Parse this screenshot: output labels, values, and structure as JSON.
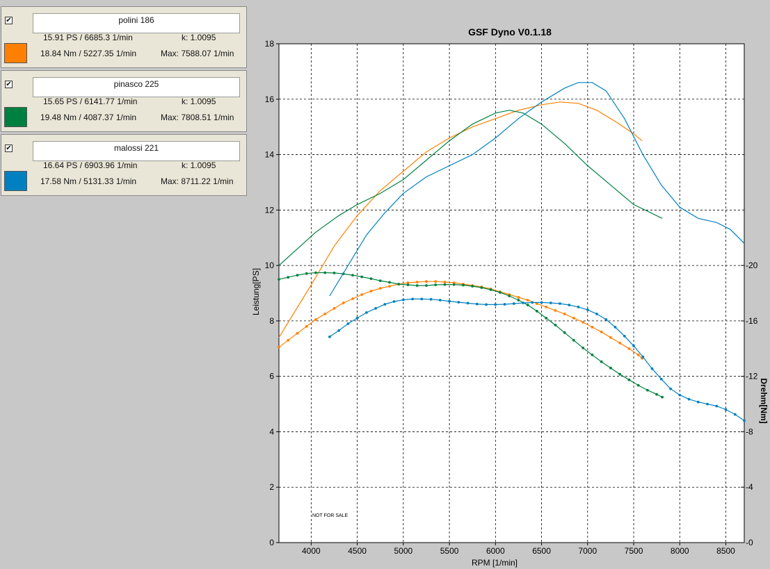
{
  "panels": [
    {
      "checked": true,
      "check_glyph": "✔",
      "name": "polini 186",
      "color": "#ff8000",
      "ps_line": "15.91 PS / 6685.3 1/min",
      "nm_line": "18.84 Nm / 5227.35 1/min",
      "k_line": "k: 1.0095",
      "max_line": "Max: 7588.07 1/min"
    },
    {
      "checked": true,
      "check_glyph": "✔",
      "name": "pinasco 225",
      "color": "#008040",
      "ps_line": "15.65 PS / 6141.77 1/min",
      "nm_line": "19.48 Nm / 4087.37 1/min",
      "k_line": "k: 1.0095",
      "max_line": "Max: 7808.51 1/min"
    },
    {
      "checked": true,
      "check_glyph": "✔",
      "name": "malossi 221",
      "color": "#0080c0",
      "ps_line": "16.64 PS / 6903.96 1/min",
      "nm_line": "17.58 Nm / 5131.33 1/min",
      "k_line": "k: 1.0095",
      "max_line": "Max: 8711.22 1/min"
    }
  ],
  "chart_data": {
    "type": "line",
    "title": "GSF Dyno V0.1.18",
    "xlabel": "RPM [1/min]",
    "ylabel": "Leistung[PS]",
    "y2label": "Drehm[Nm]",
    "watermark": "NOT FOR SALE",
    "xlim": [
      3650,
      8700
    ],
    "ylim": [
      0,
      18
    ],
    "y2lim": [
      0,
      36
    ],
    "x_ticks": [
      4000,
      4500,
      5000,
      5500,
      6000,
      6500,
      7000,
      7500,
      8000,
      8500
    ],
    "y_ticks": [
      0,
      2,
      4,
      6,
      8,
      10,
      12,
      14,
      16,
      18
    ],
    "y2_ticks": [
      0,
      4,
      8,
      12,
      16,
      20
    ],
    "grid": true,
    "series": [
      {
        "name": "polini 186",
        "color": "#ff8000",
        "power": [
          [
            3650,
            7.4
          ],
          [
            4000,
            9.3
          ],
          [
            4250,
            10.7
          ],
          [
            4500,
            11.8
          ],
          [
            4750,
            12.7
          ],
          [
            5000,
            13.4
          ],
          [
            5250,
            14.1
          ],
          [
            5500,
            14.6
          ],
          [
            5750,
            15.0
          ],
          [
            6000,
            15.3
          ],
          [
            6250,
            15.6
          ],
          [
            6500,
            15.8
          ],
          [
            6700,
            15.9
          ],
          [
            6900,
            15.85
          ],
          [
            7100,
            15.6
          ],
          [
            7300,
            15.2
          ],
          [
            7500,
            14.75
          ],
          [
            7590,
            14.5
          ]
        ],
        "torque": [
          [
            3650,
            14.1
          ],
          [
            3750,
            14.6
          ],
          [
            3850,
            15.1
          ],
          [
            3950,
            15.6
          ],
          [
            4050,
            16.1
          ],
          [
            4150,
            16.5
          ],
          [
            4250,
            16.9
          ],
          [
            4350,
            17.3
          ],
          [
            4450,
            17.6
          ],
          [
            4550,
            17.9
          ],
          [
            4650,
            18.15
          ],
          [
            4750,
            18.35
          ],
          [
            4850,
            18.5
          ],
          [
            4950,
            18.65
          ],
          [
            5050,
            18.75
          ],
          [
            5150,
            18.8
          ],
          [
            5250,
            18.84
          ],
          [
            5350,
            18.84
          ],
          [
            5450,
            18.8
          ],
          [
            5550,
            18.75
          ],
          [
            5650,
            18.65
          ],
          [
            5750,
            18.55
          ],
          [
            5850,
            18.45
          ],
          [
            5950,
            18.3
          ],
          [
            6050,
            18.1
          ],
          [
            6150,
            17.9
          ],
          [
            6250,
            17.7
          ],
          [
            6350,
            17.5
          ],
          [
            6450,
            17.25
          ],
          [
            6550,
            17.0
          ],
          [
            6650,
            16.75
          ],
          [
            6750,
            16.5
          ],
          [
            6850,
            16.2
          ],
          [
            6950,
            15.9
          ],
          [
            7050,
            15.55
          ],
          [
            7150,
            15.2
          ],
          [
            7250,
            14.8
          ],
          [
            7350,
            14.4
          ],
          [
            7450,
            14.0
          ],
          [
            7550,
            13.55
          ],
          [
            7590,
            13.3
          ]
        ]
      },
      {
        "name": "pinasco 225",
        "color": "#008040",
        "power": [
          [
            3650,
            10.0
          ],
          [
            3850,
            10.6
          ],
          [
            4050,
            11.2
          ],
          [
            4300,
            11.8
          ],
          [
            4500,
            12.2
          ],
          [
            4750,
            12.6
          ],
          [
            5000,
            13.1
          ],
          [
            5250,
            13.8
          ],
          [
            5500,
            14.5
          ],
          [
            5750,
            15.1
          ],
          [
            6000,
            15.5
          ],
          [
            6150,
            15.6
          ],
          [
            6300,
            15.5
          ],
          [
            6500,
            15.1
          ],
          [
            6750,
            14.4
          ],
          [
            7000,
            13.6
          ],
          [
            7250,
            12.9
          ],
          [
            7500,
            12.2
          ],
          [
            7810,
            11.7
          ]
        ],
        "torque": [
          [
            3650,
            19.0
          ],
          [
            3750,
            19.15
          ],
          [
            3850,
            19.3
          ],
          [
            3950,
            19.42
          ],
          [
            4050,
            19.48
          ],
          [
            4150,
            19.48
          ],
          [
            4250,
            19.46
          ],
          [
            4350,
            19.4
          ],
          [
            4450,
            19.3
          ],
          [
            4550,
            19.18
          ],
          [
            4650,
            19.05
          ],
          [
            4750,
            18.9
          ],
          [
            4850,
            18.78
          ],
          [
            4950,
            18.65
          ],
          [
            5050,
            18.6
          ],
          [
            5150,
            18.55
          ],
          [
            5250,
            18.55
          ],
          [
            5350,
            18.6
          ],
          [
            5450,
            18.62
          ],
          [
            5550,
            18.62
          ],
          [
            5650,
            18.58
          ],
          [
            5750,
            18.5
          ],
          [
            5850,
            18.4
          ],
          [
            5950,
            18.25
          ],
          [
            6050,
            18.05
          ],
          [
            6150,
            17.8
          ],
          [
            6250,
            17.5
          ],
          [
            6350,
            17.15
          ],
          [
            6450,
            16.7
          ],
          [
            6550,
            16.2
          ],
          [
            6650,
            15.7
          ],
          [
            6750,
            15.15
          ],
          [
            6850,
            14.6
          ],
          [
            6950,
            14.05
          ],
          [
            7050,
            13.55
          ],
          [
            7150,
            13.05
          ],
          [
            7250,
            12.6
          ],
          [
            7350,
            12.15
          ],
          [
            7450,
            11.75
          ],
          [
            7550,
            11.35
          ],
          [
            7650,
            11.0
          ],
          [
            7750,
            10.7
          ],
          [
            7810,
            10.5
          ]
        ]
      },
      {
        "name": "malossi 221",
        "color": "#0080c0",
        "power": [
          [
            4200,
            8.9
          ],
          [
            4400,
            10.0
          ],
          [
            4600,
            11.1
          ],
          [
            4800,
            11.9
          ],
          [
            5000,
            12.6
          ],
          [
            5250,
            13.2
          ],
          [
            5500,
            13.6
          ],
          [
            5750,
            14.0
          ],
          [
            6000,
            14.6
          ],
          [
            6250,
            15.3
          ],
          [
            6500,
            15.9
          ],
          [
            6750,
            16.4
          ],
          [
            6900,
            16.6
          ],
          [
            7050,
            16.6
          ],
          [
            7200,
            16.3
          ],
          [
            7400,
            15.3
          ],
          [
            7600,
            14.0
          ],
          [
            7800,
            12.9
          ],
          [
            8000,
            12.1
          ],
          [
            8200,
            11.7
          ],
          [
            8400,
            11.55
          ],
          [
            8550,
            11.3
          ],
          [
            8700,
            10.8
          ]
        ],
        "torque": [
          [
            4200,
            14.85
          ],
          [
            4300,
            15.3
          ],
          [
            4400,
            15.8
          ],
          [
            4500,
            16.2
          ],
          [
            4600,
            16.6
          ],
          [
            4700,
            16.9
          ],
          [
            4800,
            17.2
          ],
          [
            4900,
            17.4
          ],
          [
            5000,
            17.52
          ],
          [
            5100,
            17.58
          ],
          [
            5200,
            17.58
          ],
          [
            5300,
            17.56
          ],
          [
            5400,
            17.5
          ],
          [
            5500,
            17.42
          ],
          [
            5600,
            17.35
          ],
          [
            5700,
            17.28
          ],
          [
            5800,
            17.22
          ],
          [
            5900,
            17.18
          ],
          [
            6000,
            17.18
          ],
          [
            6100,
            17.2
          ],
          [
            6200,
            17.25
          ],
          [
            6300,
            17.3
          ],
          [
            6400,
            17.33
          ],
          [
            6500,
            17.33
          ],
          [
            6600,
            17.3
          ],
          [
            6700,
            17.25
          ],
          [
            6800,
            17.15
          ],
          [
            6900,
            17.0
          ],
          [
            7000,
            16.8
          ],
          [
            7100,
            16.5
          ],
          [
            7200,
            16.1
          ],
          [
            7300,
            15.55
          ],
          [
            7400,
            14.9
          ],
          [
            7500,
            14.2
          ],
          [
            7600,
            13.4
          ],
          [
            7700,
            12.55
          ],
          [
            7800,
            11.8
          ],
          [
            7900,
            11.1
          ],
          [
            8000,
            10.65
          ],
          [
            8100,
            10.35
          ],
          [
            8200,
            10.15
          ],
          [
            8300,
            10.0
          ],
          [
            8400,
            9.85
          ],
          [
            8500,
            9.6
          ],
          [
            8600,
            9.25
          ],
          [
            8700,
            8.8
          ]
        ]
      }
    ]
  }
}
